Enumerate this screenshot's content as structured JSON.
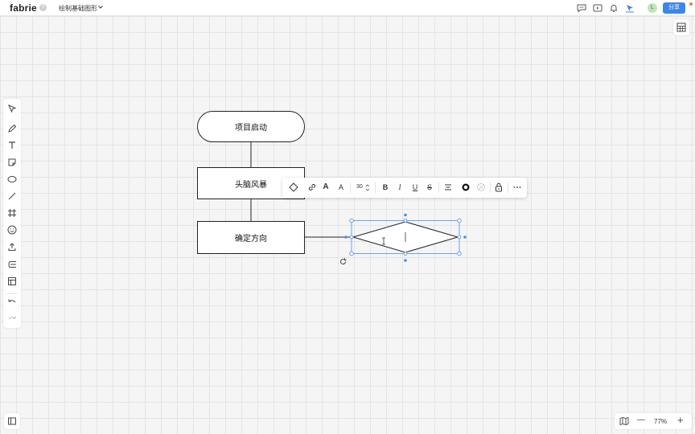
{
  "app": {
    "logo": "fabrie",
    "logo_badge": "?",
    "doc_title": "绘制基础图形"
  },
  "header": {
    "icons": [
      "comment-icon",
      "present-icon",
      "bell-icon",
      "cursor-follow-icon"
    ],
    "avatar_letter": "L",
    "share_label": "分享"
  },
  "left_toolbar": {
    "tools": [
      "select-icon",
      "pen-icon",
      "text-icon",
      "sticky-note-icon",
      "shape-icon",
      "line-icon",
      "frame-icon",
      "emoji-icon",
      "upload-icon",
      "mindmap-icon",
      "template-icon"
    ],
    "history": [
      "undo-icon",
      "redo-icon"
    ]
  },
  "flowchart": {
    "start": "项目启动",
    "brainstorm": "头脑风暴",
    "direction": "确定方向"
  },
  "shape_toolbar": {
    "font_size": "30",
    "bold": "B",
    "italic": "I",
    "underline": "U",
    "strike": "S",
    "text_color_letter": "A",
    "font_letter": "A"
  },
  "zoom": {
    "level": "77%",
    "minus": "—",
    "plus": "+"
  },
  "colors": {
    "accent": "#3d86e6",
    "selection": "#4a90e2"
  }
}
